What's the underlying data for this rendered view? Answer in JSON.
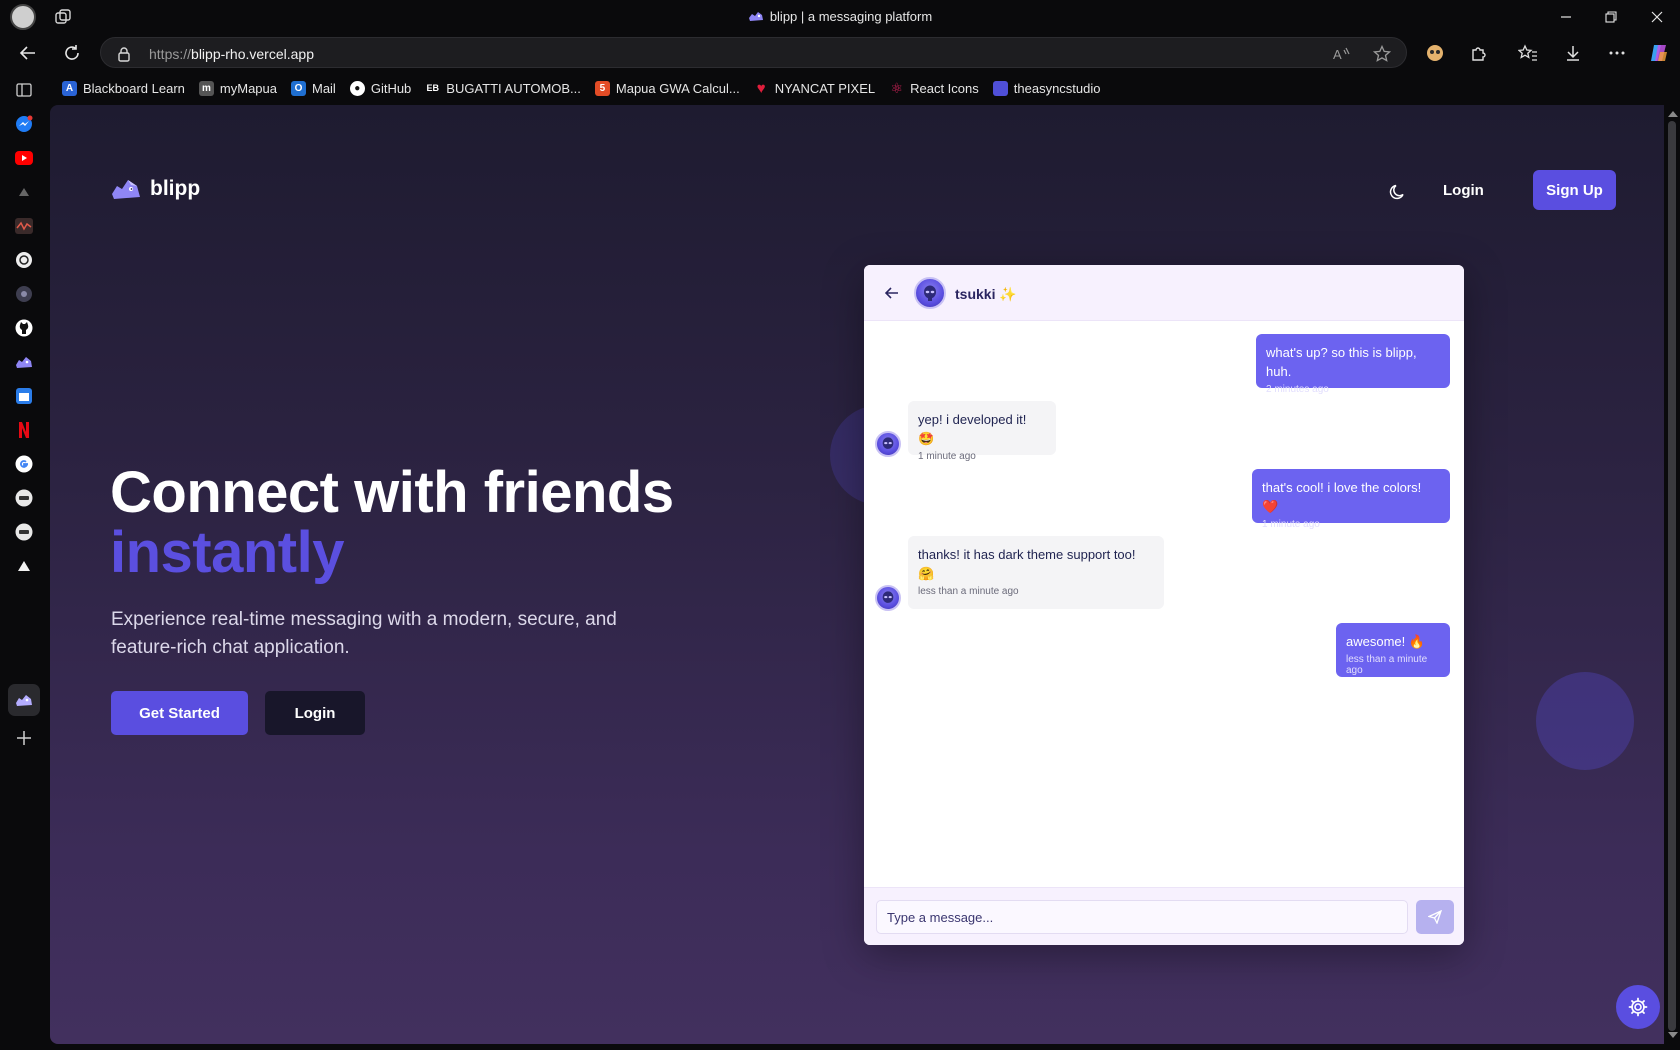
{
  "browser": {
    "tab_title": "blipp | a messaging platform",
    "url_scheme": "https://",
    "url_host": "blipp-rho.vercel.app",
    "bookmarks": [
      {
        "label": "Blackboard Learn",
        "icon": "blackboard-icon",
        "color": "#2a64d6"
      },
      {
        "label": "myMapua",
        "icon": "mymapua-icon",
        "color": "#555555"
      },
      {
        "label": "Mail",
        "icon": "outlook-icon",
        "color": "#1f6fd1"
      },
      {
        "label": "GitHub",
        "icon": "github-icon",
        "color": "#222222"
      },
      {
        "label": "BUGATTI AUTOMOB...",
        "icon": "bugatti-icon",
        "color": "#222222"
      },
      {
        "label": "Mapua GWA Calcul...",
        "icon": "html5-icon",
        "color": "#e34c26"
      },
      {
        "label": "NYANCAT PIXEL",
        "icon": "heart-icon",
        "color": "#e01e3c"
      },
      {
        "label": "React Icons",
        "icon": "react-icon",
        "color": "#e0245e"
      },
      {
        "label": "theasyncstudio",
        "icon": "folder-icon",
        "color": "#4f4fd8"
      }
    ]
  },
  "nav": {
    "brand": "blipp",
    "login": "Login",
    "signup": "Sign Up"
  },
  "hero": {
    "title": "Connect with friends",
    "accent": "instantly",
    "subtitle": "Experience real-time messaging with a modern, secure, and feature-rich chat application.",
    "cta_primary": "Get Started",
    "cta_secondary": "Login"
  },
  "chat": {
    "contact_name": "tsukki ✨",
    "messages": [
      {
        "dir": "out",
        "text": "what's up? so this is blipp, huh.",
        "time": "2 minutes ago"
      },
      {
        "dir": "in",
        "text": "yep! i developed it! 🤩",
        "time": "1 minute ago"
      },
      {
        "dir": "out",
        "text": "that's cool! i love the colors! ❤️",
        "time": "1 minute ago"
      },
      {
        "dir": "in",
        "text": "thanks! it has dark theme support too! 🤗",
        "time": "less than a minute ago"
      },
      {
        "dir": "out",
        "text": "awesome! 🔥",
        "time": "less than a minute ago"
      }
    ],
    "input_placeholder": "Type a message..."
  },
  "colors": {
    "accent": "#5a4ee0",
    "bubble_out": "#6c63f0",
    "bubble_in": "#f4f4f6"
  }
}
